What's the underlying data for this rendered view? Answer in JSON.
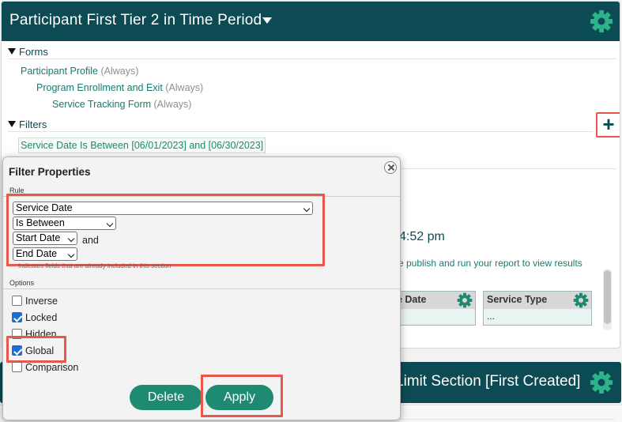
{
  "main": {
    "title": "Participant First Tier 2 in Time Period",
    "forms": {
      "heading": "Forms",
      "items": [
        {
          "label": "Participant Profile",
          "qualifier": "(Always)"
        },
        {
          "label": "Program Enrollment and Exit",
          "qualifier": "(Always)"
        },
        {
          "label": "Service Tracking Form",
          "qualifier": "(Always)"
        }
      ]
    },
    "filters": {
      "heading": "Filters",
      "add_label": "+",
      "items": [
        {
          "label": "Service Date Is Between [06/01/2023] and [06/30/2023]"
        }
      ]
    },
    "background": {
      "time_text": "4:52 pm",
      "note_text": "se publish and run your report to view results",
      "columns": [
        {
          "header": "ce Date",
          "body": ""
        },
        {
          "header": "Service Type",
          "body": "..."
        }
      ]
    }
  },
  "second_section": {
    "title": "Limit Section [First Created]"
  },
  "dialog": {
    "title": "Filter Properties",
    "rule_heading": "Rule",
    "field_select": "Service Date",
    "operator_select": "Is Between",
    "start_select": "Start Date",
    "and_text": "and",
    "end_select": "End Date",
    "hint_text": "Indicates fields that are already included in this section",
    "options_heading": "Options",
    "options": [
      {
        "label": "Inverse",
        "checked": false
      },
      {
        "label": "Locked",
        "checked": true
      },
      {
        "label": "Hidden",
        "checked": false
      },
      {
        "label": "Global",
        "checked": true
      },
      {
        "label": "Comparison",
        "checked": false
      }
    ],
    "delete_label": "Delete",
    "apply_label": "Apply"
  },
  "icons": {
    "gear": "gear-icon",
    "close": "close-icon",
    "caret": "caret-down-icon",
    "triangle": "triangle-down-icon"
  },
  "colors": {
    "header_bg": "#0d4b54",
    "accent_green": "#1f8a72",
    "link_green": "#1a7a6e",
    "highlight_red": "#e8564c"
  }
}
